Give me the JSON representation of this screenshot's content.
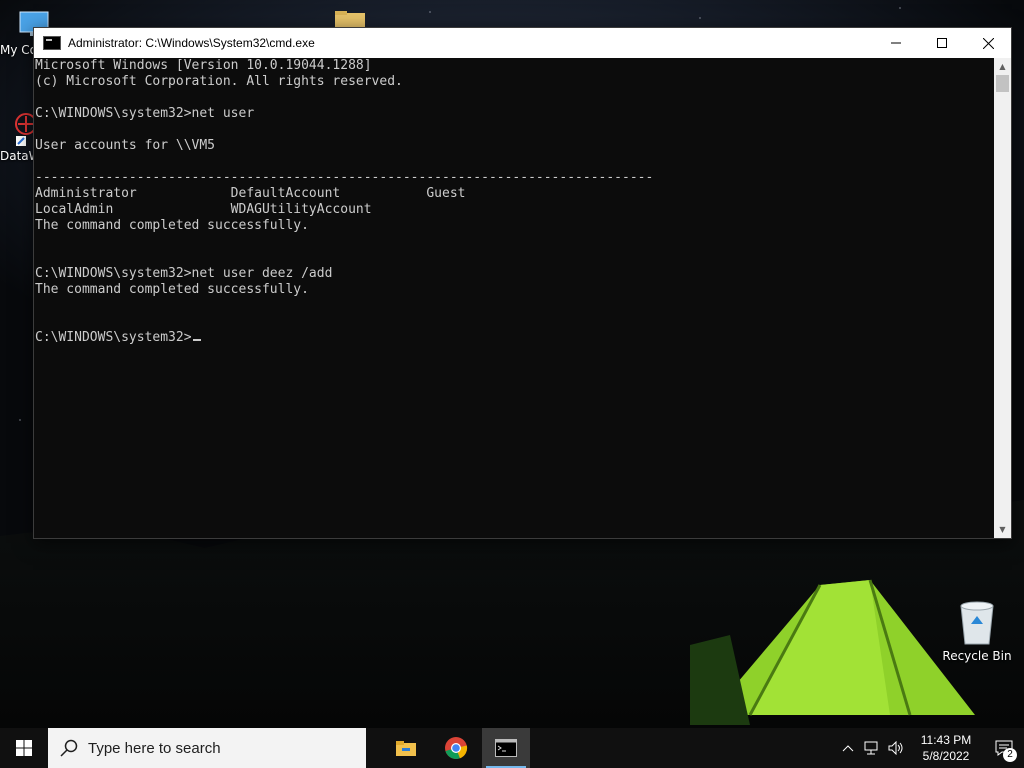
{
  "desktop": {
    "icons": {
      "my_computer": "My Co",
      "dataw": "DataW",
      "recycle_bin": "Recycle Bin"
    }
  },
  "window": {
    "title": "Administrator: C:\\Windows\\System32\\cmd.exe",
    "console_lines": [
      "Microsoft Windows [Version 10.0.19044.1288]",
      "(c) Microsoft Corporation. All rights reserved.",
      "",
      "C:\\WINDOWS\\system32>net user",
      "",
      "User accounts for \\\\VM5",
      "",
      "-------------------------------------------------------------------------------",
      "Administrator            DefaultAccount           Guest",
      "LocalAdmin               WDAGUtilityAccount",
      "The command completed successfully.",
      "",
      "",
      "C:\\WINDOWS\\system32>net user deez /add",
      "The command completed successfully.",
      "",
      "",
      "C:\\WINDOWS\\system32>"
    ]
  },
  "taskbar": {
    "search_placeholder": "Type here to search",
    "clock_time": "11:43 PM",
    "clock_date": "5/8/2022",
    "notification_count": "2"
  },
  "colors": {
    "console_bg": "#0c0c0c",
    "console_text": "#cccccc",
    "taskbar_bg": "#101010",
    "active_indicator": "#76b9ed"
  }
}
